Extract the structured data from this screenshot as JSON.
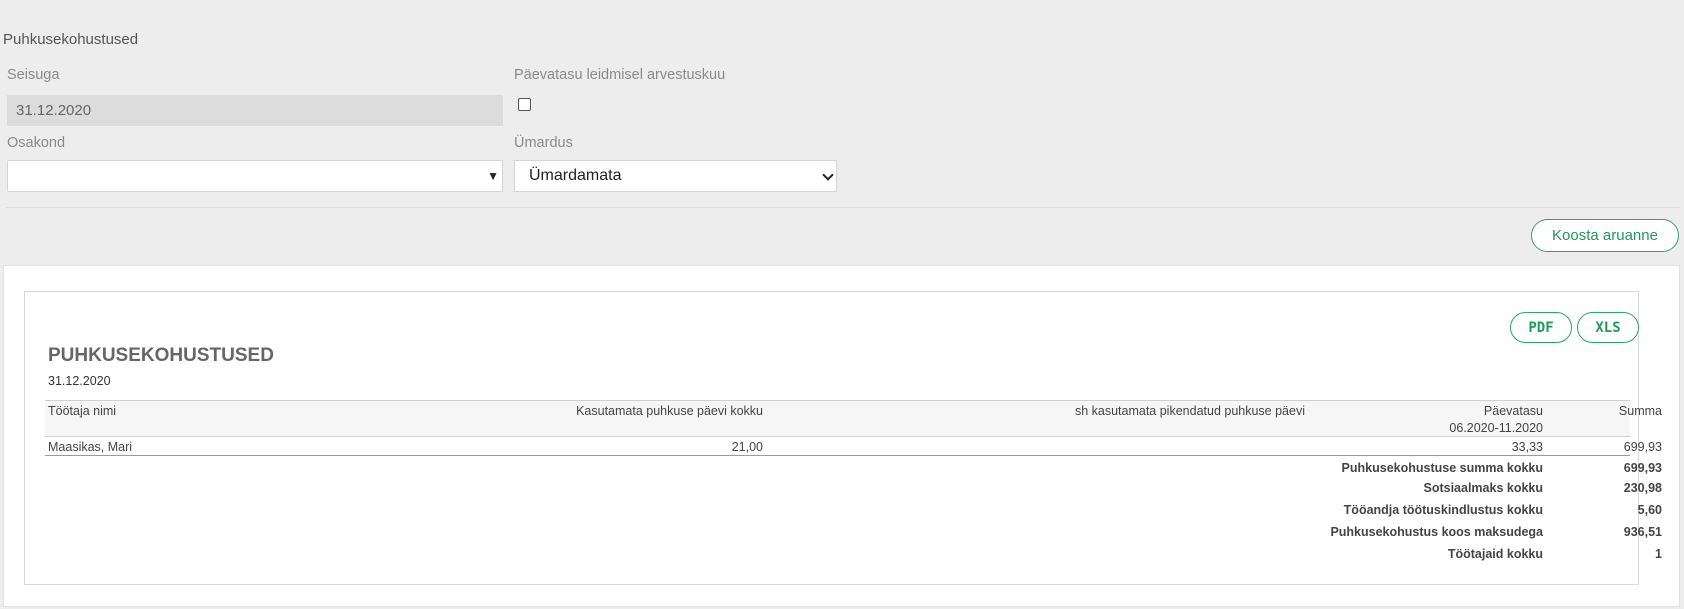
{
  "page": {
    "title": "Puhkusekohustused"
  },
  "form": {
    "seisuga_label": "Seisuga",
    "seisuga_value": "31.12.2020",
    "paevatasu_label": "Päevatasu leidmisel arvestuskuu",
    "paevatasu_checked": false,
    "osakond_label": "Osakond",
    "osakond_value": "",
    "umardus_label": "Ümardus",
    "umardus_value": "Ümardamata"
  },
  "actions": {
    "build_report": "Koosta aruanne"
  },
  "report": {
    "pdf_label": "PDF",
    "xls_label": "XLS",
    "title": "PUHKUSEKOHUSTUSED",
    "date": "31.12.2020",
    "columns": {
      "name": "Töötaja nimi",
      "unused_days": "Kasutamata puhkuse päevi kokku",
      "extended_days": "sh kasutamata pikendatud puhkuse päevi",
      "daily_rate": "Päevatasu",
      "daily_rate_period": "06.2020-11.2020",
      "sum": "Summa"
    },
    "rows": [
      {
        "name": "Maasikas, Mari",
        "unused_days": "21,00",
        "extended_days": "",
        "daily_rate": "33,33",
        "sum": "699,93"
      }
    ],
    "totals": [
      {
        "label": "Puhkusekohustuse summa kokku",
        "value": "699,93"
      },
      {
        "label": "Sotsiaalmaks kokku",
        "value": "230,98"
      },
      {
        "label": "Tööandja töötuskindlustus kokku",
        "value": "5,60"
      },
      {
        "label": "Puhkusekohustus koos maksudega",
        "value": "936,51"
      },
      {
        "label": "Töötajaid kokku",
        "value": "1"
      }
    ]
  },
  "colors": {
    "accent": "#1f9a5c",
    "background": "#ededed"
  }
}
